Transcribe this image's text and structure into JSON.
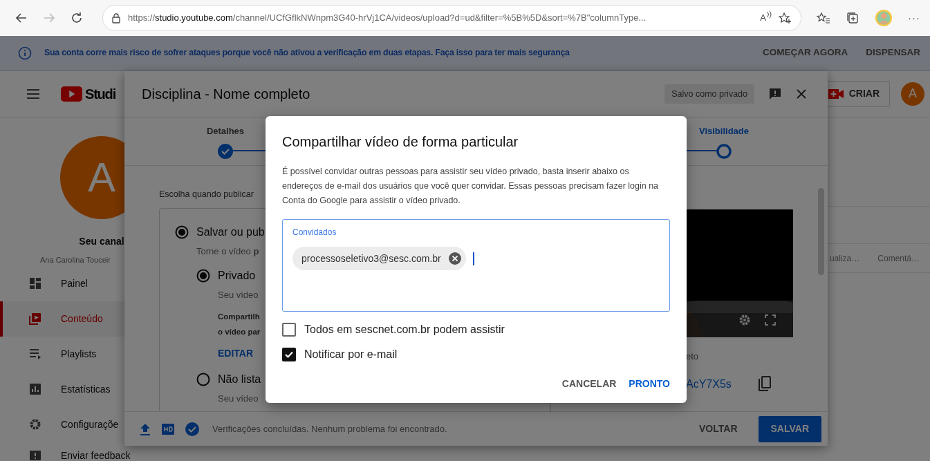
{
  "browser": {
    "url": "https://**studio.youtube.com**/channel/UCfGflkNWnpm3G40-hrVj1CA/videos/upload?d=ud&filter=%5B%5D&sort=%7B\"columnType...",
    "read_aloud": "A",
    "more": "···"
  },
  "banner": {
    "message": "Sua conta corre mais risco de sofrer ataques porque você não ativou a verificação em duas etapas. Faça isso para ter mais segurança",
    "actions": [
      "COMEÇAR AGORA",
      "DISPENSAR"
    ]
  },
  "header": {
    "logo_text": "Studi",
    "create_button": "CRIAR",
    "avatar": "A"
  },
  "channel": {
    "avatar": "A",
    "title": "Seu canal",
    "name": "Ana Carolina Touceir"
  },
  "sidebar": {
    "items": [
      {
        "label": "Painel",
        "selected": false
      },
      {
        "label": "Conteúdo",
        "selected": true
      },
      {
        "label": "Playlists",
        "selected": false
      },
      {
        "label": "Estatísticas",
        "selected": false
      },
      {
        "label": "Configuraçõe",
        "selected": false
      },
      {
        "label": "Enviar feedback",
        "selected": false
      }
    ]
  },
  "table": {
    "columns": [
      "ualiza…",
      "Comentá…"
    ]
  },
  "upload_dialog": {
    "title": "Disciplina - Nome completo",
    "save_status": "Salvo como privado",
    "steps": [
      {
        "label": "Detalhes",
        "done": true,
        "selected": false
      },
      {
        "label": "Visibilidade",
        "done": false,
        "selected": true
      }
    ],
    "subtitle": "Escolha quando publicar",
    "options": [
      {
        "label": "Salvar ou pub",
        "description": "Torne o vídeo **p**",
        "selected": true,
        "children": [
          {
            "label": "Privado",
            "description": "Seu vídeo",
            "selected": true,
            "share_lines": [
              "Compartilh",
              "o vídeo par"
            ],
            "action": "EDITAR"
          },
          {
            "label": "Não lista",
            "description": "Seu vídeo",
            "selected": false
          }
        ]
      }
    ],
    "video_title": "eto",
    "video_link": "AcY7X5s",
    "status": "Verificações concluídas. Nenhum problema foi encontrado.",
    "buttons": [
      {
        "label": "VOLTAR",
        "kind": "text"
      },
      {
        "label": "SALVAR",
        "kind": "filled"
      }
    ]
  },
  "share_dialog": {
    "title": "Compartilhar vídeo de forma particular",
    "description": "É possível convidar outras pessoas para assistir seu vídeo privado, basta inserir abaixo os endereços de e-mail dos usuários que você quer convidar. Essas pessoas precisam fazer login na Conta do Google para assistir o vídeo privado.",
    "field": {
      "label": "Convidados",
      "chips": [
        "processoseletivo3@sesc.com.br"
      ]
    },
    "checkboxes": [
      {
        "label": "Todos em sescnet.com.br podem assistir",
        "checked": false
      },
      {
        "label": "Notificar por e-mail",
        "checked": true
      }
    ],
    "buttons": [
      {
        "label": "CANCELAR",
        "kind": "text"
      },
      {
        "label": "PRONTO",
        "kind": "primary"
      }
    ]
  }
}
